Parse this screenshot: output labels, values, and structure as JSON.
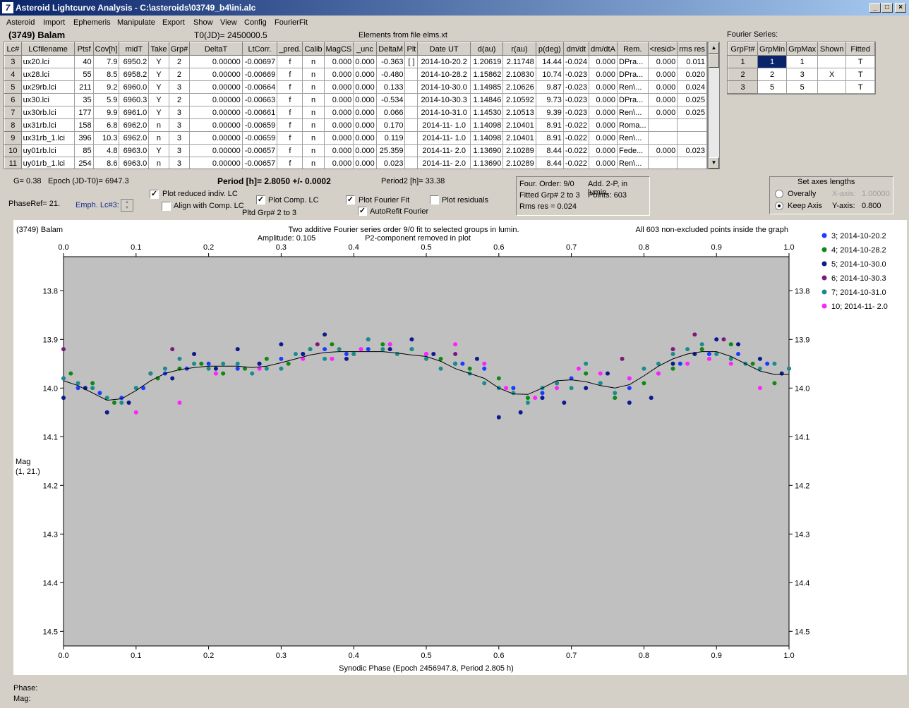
{
  "window": {
    "title": "Asteroid Lightcurve Analysis - C:\\asteroids\\03749_b4\\ini.alc",
    "app_icon": "lightcurve-icon",
    "min": "_",
    "max": "□",
    "close": "×"
  },
  "menu": [
    "Asteroid",
    "Import",
    "Ephemeris",
    "Manipulate",
    "Export",
    "Show",
    "View",
    "Config",
    "FourierFit"
  ],
  "header": {
    "object": "(3749) Balam",
    "t0": "T0(JD)= 2450000.5",
    "elements": "Elements from file elms.xt",
    "fourier_label": "Fourier Series:"
  },
  "lc_table": {
    "columns": [
      "Lc#",
      "LCfilename",
      "Ptsf",
      "Cov[h]",
      "midT",
      "Take",
      "Grp#",
      "DeltaT",
      "LtCorr.",
      "_pred.",
      "Calib",
      "MagCS",
      "_unc",
      "DeltaM",
      "Plt",
      "Date UT",
      "d(au)",
      "r(au)",
      "p(deg)",
      "dm/dt",
      "dm/dtA",
      "Rem.",
      "<resid>",
      "rms res"
    ],
    "rows": [
      [
        "3",
        "ux20.lci",
        "40",
        "7.9",
        "6950.2",
        "Y",
        "2",
        "0.00000",
        "-0.00697",
        "f",
        "n",
        "0.000",
        "0.000",
        "-0.363",
        "[ ]",
        "2014-10-20.2",
        "1.20619",
        "2.11748",
        "14.44",
        "-0.024",
        "0.000",
        "DPra...",
        "0.000",
        "0.011"
      ],
      [
        "4",
        "ux28.lci",
        "55",
        "8.5",
        "6958.2",
        "Y",
        "2",
        "0.00000",
        "-0.00669",
        "f",
        "n",
        "0.000",
        "0.000",
        "-0.480",
        "",
        "2014-10-28.2",
        "1.15862",
        "2.10830",
        "10.74",
        "-0.023",
        "0.000",
        "DPra...",
        "0.000",
        "0.020"
      ],
      [
        "5",
        "ux29rb.lci",
        "211",
        "9.2",
        "6960.0",
        "Y",
        "3",
        "0.00000",
        "-0.00664",
        "f",
        "n",
        "0.000",
        "0.000",
        "0.133",
        "",
        "2014-10-30.0",
        "1.14985",
        "2.10626",
        "9.87",
        "-0.023",
        "0.000",
        "Ren\\...",
        "0.000",
        "0.024"
      ],
      [
        "6",
        "ux30.lci",
        "35",
        "5.9",
        "6960.3",
        "Y",
        "2",
        "0.00000",
        "-0.00663",
        "f",
        "n",
        "0.000",
        "0.000",
        "-0.534",
        "",
        "2014-10-30.3",
        "1.14846",
        "2.10592",
        "9.73",
        "-0.023",
        "0.000",
        "DPra...",
        "0.000",
        "0.025"
      ],
      [
        "7",
        "ux30rb.lci",
        "177",
        "9.9",
        "6961.0",
        "Y",
        "3",
        "0.00000",
        "-0.00661",
        "f",
        "n",
        "0.000",
        "0.000",
        "0.066",
        "",
        "2014-10-31.0",
        "1.14530",
        "2.10513",
        "9.39",
        "-0.023",
        "0.000",
        "Ren\\...",
        "0.000",
        "0.025"
      ],
      [
        "8",
        "ux31rb.lci",
        "158",
        "6.8",
        "6962.0",
        "n",
        "3",
        "0.00000",
        "-0.00659",
        "f",
        "n",
        "0.000",
        "0.000",
        "0.170",
        "",
        "2014-11- 1.0",
        "1.14098",
        "2.10401",
        "8.91",
        "-0.022",
        "0.000",
        "Roma...",
        "",
        ""
      ],
      [
        "9",
        "ux31rb_1.lci",
        "396",
        "10.3",
        "6962.0",
        "n",
        "3",
        "0.00000",
        "-0.00659",
        "f",
        "n",
        "0.000",
        "0.000",
        "0.119",
        "",
        "2014-11- 1.0",
        "1.14098",
        "2.10401",
        "8.91",
        "-0.022",
        "0.000",
        "Ren\\...",
        "",
        ""
      ],
      [
        "10",
        "uy01rb.lci",
        "85",
        "4.8",
        "6963.0",
        "Y",
        "3",
        "0.00000",
        "-0.00657",
        "f",
        "n",
        "0.000",
        "0.000",
        "25.359",
        "",
        "2014-11- 2.0",
        "1.13690",
        "2.10289",
        "8.44",
        "-0.022",
        "0.000",
        "Fede...",
        "0.000",
        "0.023"
      ],
      [
        "11",
        "uy01rb_1.lci",
        "254",
        "8.6",
        "6963.0",
        "n",
        "3",
        "0.00000",
        "-0.00657",
        "f",
        "n",
        "0.000",
        "0.000",
        "0.023",
        "",
        "2014-11- 2.0",
        "1.13690",
        "2.10289",
        "8.44",
        "-0.022",
        "0.000",
        "Ren\\...",
        "",
        ""
      ]
    ]
  },
  "fourier_table": {
    "columns": [
      "GrpFt#",
      "GrpMin",
      "GrpMax",
      "Shown",
      "Fitted"
    ],
    "rows": [
      [
        "1",
        "1",
        "1",
        "",
        "T"
      ],
      [
        "2",
        "2",
        "3",
        "X",
        "T"
      ],
      [
        "3",
        "5",
        "5",
        "",
        "T"
      ]
    ]
  },
  "controls": {
    "g": "G= 0.38",
    "epoch": "Epoch (JD-T0)= 6947.3",
    "period": "Period [h]= 2.8050 +/- 0.0002",
    "period2": "Period2 [h]= 33.38",
    "phaseref": "PhaseRef= 21.",
    "emph": "Emph. Lc#3:",
    "plot_reduced": {
      "label": "Plot reduced indiv. LC",
      "checked": true
    },
    "align": {
      "label": "Align with Comp. LC",
      "checked": false
    },
    "plot_comp": {
      "label": "Plot Comp. LC",
      "checked": true
    },
    "plot_fourier": {
      "label": "Plot Fourier Fit",
      "checked": true
    },
    "autorefit": {
      "label": "AutoRefit Fourier",
      "checked": true
    },
    "plot_resid": {
      "label": "Plot residuals",
      "checked": false
    },
    "pltd": "Pltd Grp# 2  to  3",
    "info": [
      "Four. Order:  9/0",
      "Add. 2-P, in lumin.",
      "Fitted Grp# 2 to 3",
      "Points: 603",
      "Rms res     = 0.024"
    ],
    "axes": {
      "title": "Set axes lengths",
      "overall": "Overally",
      "keep": "Keep Axis",
      "xaxis_label": "X-axis:",
      "xaxis_val": "1.00000",
      "yaxis_label": "Y-axis:",
      "yaxis_val": "0.800"
    }
  },
  "chart_data": {
    "type": "scatter",
    "title_left": "(3749) Balam",
    "title_center": "Two additive Fourier series order 9/0 fit to selected groups in lumin.",
    "amplitude": "Amplitude: 0.105",
    "p2_note": "P2-component removed in plot",
    "points_note": "All 603 non-excluded points inside the graph",
    "xlabel": "Synodic Phase (Epoch 2456947.8, Period 2.805 h)",
    "ylabel_line1": "Mag",
    "ylabel_line2": "(1, 21.)",
    "xlim": [
      0,
      1
    ],
    "ylim": [
      13.73,
      14.53
    ],
    "y_inverted": true,
    "x_ticks": [
      "0.0",
      "0.1",
      "0.2",
      "0.3",
      "0.4",
      "0.5",
      "0.6",
      "0.7",
      "0.8",
      "0.9",
      "1.0"
    ],
    "y_ticks": [
      "13.8",
      "13.9",
      "14.0",
      "14.1",
      "14.2",
      "14.3",
      "14.4",
      "14.5"
    ],
    "y_tick_values": [
      13.8,
      13.9,
      14.0,
      14.1,
      14.2,
      14.3,
      14.4,
      14.5
    ],
    "series": [
      {
        "name": "3; 2014-10-20.2",
        "color": "#1a3cff"
      },
      {
        "name": "4; 2014-10-28.2",
        "color": "#118811"
      },
      {
        "name": "5; 2014-10-30.0",
        "color": "#0b1a8c"
      },
      {
        "name": "6; 2014-10-30.3",
        "color": "#7a1a7a"
      },
      {
        "name": "7; 2014-10-31.0",
        "color": "#1a8c8c"
      },
      {
        "name": "10; 2014-11- 2.0",
        "color": "#ff22ff"
      }
    ],
    "fit_curve": {
      "x": [
        0.0,
        0.02,
        0.04,
        0.06,
        0.08,
        0.1,
        0.12,
        0.14,
        0.16,
        0.18,
        0.2,
        0.22,
        0.24,
        0.26,
        0.28,
        0.3,
        0.32,
        0.34,
        0.36,
        0.38,
        0.4,
        0.42,
        0.44,
        0.46,
        0.48,
        0.5,
        0.52,
        0.54,
        0.56,
        0.58,
        0.6,
        0.62,
        0.64,
        0.66,
        0.68,
        0.7,
        0.72,
        0.74,
        0.76,
        0.78,
        0.8,
        0.82,
        0.84,
        0.86,
        0.88,
        0.9,
        0.92,
        0.94,
        0.96,
        0.98,
        1.0
      ],
      "y": [
        13.985,
        13.995,
        14.01,
        14.025,
        14.022,
        14.005,
        13.985,
        13.97,
        13.962,
        13.958,
        13.955,
        13.955,
        13.955,
        13.958,
        13.955,
        13.948,
        13.94,
        13.932,
        13.927,
        13.925,
        13.925,
        13.925,
        13.925,
        13.928,
        13.932,
        13.935,
        13.945,
        13.96,
        13.97,
        13.98,
        14.0,
        14.012,
        14.013,
        14.0,
        13.985,
        13.983,
        13.987,
        13.995,
        14.0,
        13.993,
        13.975,
        13.955,
        13.94,
        13.93,
        13.925,
        13.925,
        13.935,
        13.95,
        13.965,
        13.972,
        13.972
      ]
    },
    "points": [
      {
        "s": 0,
        "x": [
          0.0,
          0.02,
          0.05,
          0.08,
          0.11,
          0.14,
          0.17,
          0.2,
          0.24,
          0.27,
          0.3,
          0.33,
          0.36,
          0.39,
          0.42,
          0.45,
          0.5,
          0.55,
          0.58,
          0.62,
          0.66,
          0.7,
          0.74,
          0.78,
          0.82,
          0.85,
          0.89,
          0.93,
          0.97,
          1.0
        ],
        "y": [
          13.98,
          14.0,
          14.01,
          14.02,
          14.0,
          13.97,
          13.96,
          13.95,
          13.96,
          13.95,
          13.94,
          13.93,
          13.92,
          13.93,
          13.92,
          13.91,
          13.93,
          13.95,
          13.96,
          14.0,
          14.01,
          13.98,
          13.99,
          14.0,
          13.97,
          13.95,
          13.93,
          13.93,
          13.95,
          13.96
        ]
      },
      {
        "s": 1,
        "x": [
          0.01,
          0.04,
          0.07,
          0.1,
          0.13,
          0.16,
          0.19,
          0.22,
          0.25,
          0.28,
          0.31,
          0.34,
          0.37,
          0.4,
          0.44,
          0.48,
          0.52,
          0.56,
          0.6,
          0.64,
          0.68,
          0.72,
          0.76,
          0.8,
          0.84,
          0.88,
          0.92,
          0.95,
          0.98
        ],
        "y": [
          13.97,
          13.99,
          14.03,
          14.0,
          13.98,
          13.96,
          13.95,
          13.97,
          13.96,
          13.94,
          13.95,
          13.92,
          13.91,
          13.93,
          13.91,
          13.92,
          13.94,
          13.96,
          13.98,
          14.02,
          13.99,
          13.97,
          14.02,
          13.99,
          13.96,
          13.92,
          13.91,
          13.95,
          13.99
        ]
      },
      {
        "s": 2,
        "x": [
          0.0,
          0.03,
          0.06,
          0.09,
          0.12,
          0.15,
          0.18,
          0.21,
          0.24,
          0.27,
          0.3,
          0.33,
          0.36,
          0.39,
          0.42,
          0.45,
          0.48,
          0.51,
          0.54,
          0.57,
          0.6,
          0.63,
          0.66,
          0.69,
          0.72,
          0.75,
          0.78,
          0.81,
          0.84,
          0.87,
          0.9,
          0.93,
          0.96,
          0.99
        ],
        "y": [
          14.02,
          14.0,
          14.05,
          14.03,
          13.97,
          13.98,
          13.93,
          13.96,
          13.92,
          13.95,
          13.91,
          13.93,
          13.89,
          13.94,
          13.9,
          13.92,
          13.9,
          13.93,
          13.95,
          13.94,
          14.06,
          14.05,
          14.02,
          14.03,
          14.0,
          13.97,
          14.03,
          14.02,
          13.95,
          13.93,
          13.9,
          13.91,
          13.94,
          13.97
        ]
      },
      {
        "s": 3,
        "x": [
          0.0,
          0.15,
          0.35,
          0.54,
          0.77,
          0.84,
          0.87,
          0.91
        ],
        "y": [
          13.92,
          13.92,
          13.91,
          13.93,
          13.94,
          13.92,
          13.89,
          13.9
        ]
      },
      {
        "s": 4,
        "x": [
          0.0,
          0.02,
          0.04,
          0.06,
          0.08,
          0.1,
          0.12,
          0.14,
          0.16,
          0.18,
          0.2,
          0.22,
          0.24,
          0.26,
          0.28,
          0.3,
          0.32,
          0.34,
          0.36,
          0.38,
          0.4,
          0.42,
          0.44,
          0.46,
          0.48,
          0.5,
          0.52,
          0.54,
          0.56,
          0.58,
          0.6,
          0.62,
          0.64,
          0.66,
          0.68,
          0.7,
          0.72,
          0.74,
          0.76,
          0.78,
          0.8,
          0.82,
          0.84,
          0.86,
          0.88,
          0.9,
          0.92,
          0.94,
          0.96,
          0.98,
          1.0
        ],
        "y": [
          13.98,
          13.99,
          14.0,
          14.02,
          14.03,
          14.0,
          13.97,
          13.96,
          13.94,
          13.95,
          13.96,
          13.95,
          13.95,
          13.97,
          13.96,
          13.96,
          13.93,
          13.92,
          13.94,
          13.92,
          13.93,
          13.9,
          13.92,
          13.93,
          13.92,
          13.94,
          13.96,
          13.95,
          13.97,
          13.99,
          14.0,
          14.01,
          14.03,
          14.0,
          13.99,
          14.0,
          13.95,
          13.99,
          14.01,
          13.98,
          13.96,
          13.95,
          13.93,
          13.92,
          13.91,
          13.93,
          13.94,
          13.95,
          13.96,
          13.95,
          13.96
        ]
      },
      {
        "s": 5,
        "x": [
          0.1,
          0.16,
          0.21,
          0.27,
          0.33,
          0.37,
          0.41,
          0.45,
          0.5,
          0.54,
          0.58,
          0.61,
          0.65,
          0.68,
          0.71,
          0.74,
          0.78,
          0.82,
          0.86,
          0.89,
          0.92,
          0.96
        ],
        "y": [
          14.05,
          14.03,
          13.97,
          13.96,
          13.94,
          13.94,
          13.92,
          13.91,
          13.93,
          13.91,
          13.95,
          14.0,
          14.02,
          14.0,
          13.96,
          13.97,
          13.98,
          13.97,
          13.95,
          13.94,
          13.95,
          14.0
        ]
      }
    ]
  },
  "status": {
    "phase": "Phase:",
    "mag": "Mag:"
  }
}
